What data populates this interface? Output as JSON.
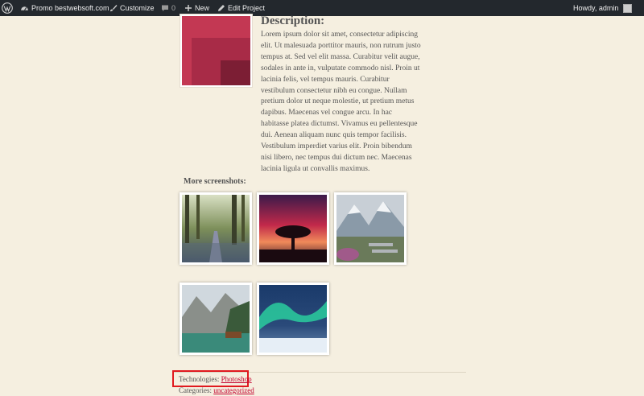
{
  "adminbar": {
    "site_name": "Promo bestwebsoft.com",
    "customize": "Customize",
    "comments_count": "0",
    "new": "New",
    "edit_project": "Edit Project",
    "howdy": "Howdy, admin"
  },
  "icons": {
    "wp_logo": "wordpress-icon",
    "site": "dashboard-icon",
    "customize": "brush-icon",
    "comments": "comment-icon",
    "new": "plus-icon",
    "edit": "pencil-icon",
    "avatar": "avatar-icon"
  },
  "content": {
    "description_heading": "Description:",
    "description_text": "Lorem ipsum dolor sit amet, consectetur adipiscing elit. Ut malesuada porttitor mauris, non rutrum justo tempus at. Sed vel elit massa. Curabitur velit augue, sodales in ante in, vulputate commodo nisl. Proin ut lacinia felis, vel tempus mauris. Curabitur vestibulum consectetur nibh eu congue. Nullam pretium dolor ut neque molestie, ut pretium metus dapibus. Maecenas vel congue arcu. In hac habitasse platea dictumst. Vivamus eu pellentesque dui. Aenean aliquam nunc quis tempor facilisis. Vestibulum imperdiet varius elit. Proin bibendum nisi libero, nec tempus dui dictum nec. Maecenas lacinia ligula ut convallis maximus.",
    "more_screenshots": "More screenshots:",
    "technologies_label": "Technologies:",
    "technologies_link": "Photoshop",
    "categories_label": "Categories:",
    "categories_link": "uncategorized"
  },
  "colors": {
    "page_bg": "#f5efe0",
    "adminbar_bg": "#23282d",
    "link": "#c2002c",
    "highlight_border": "#e0191f"
  }
}
